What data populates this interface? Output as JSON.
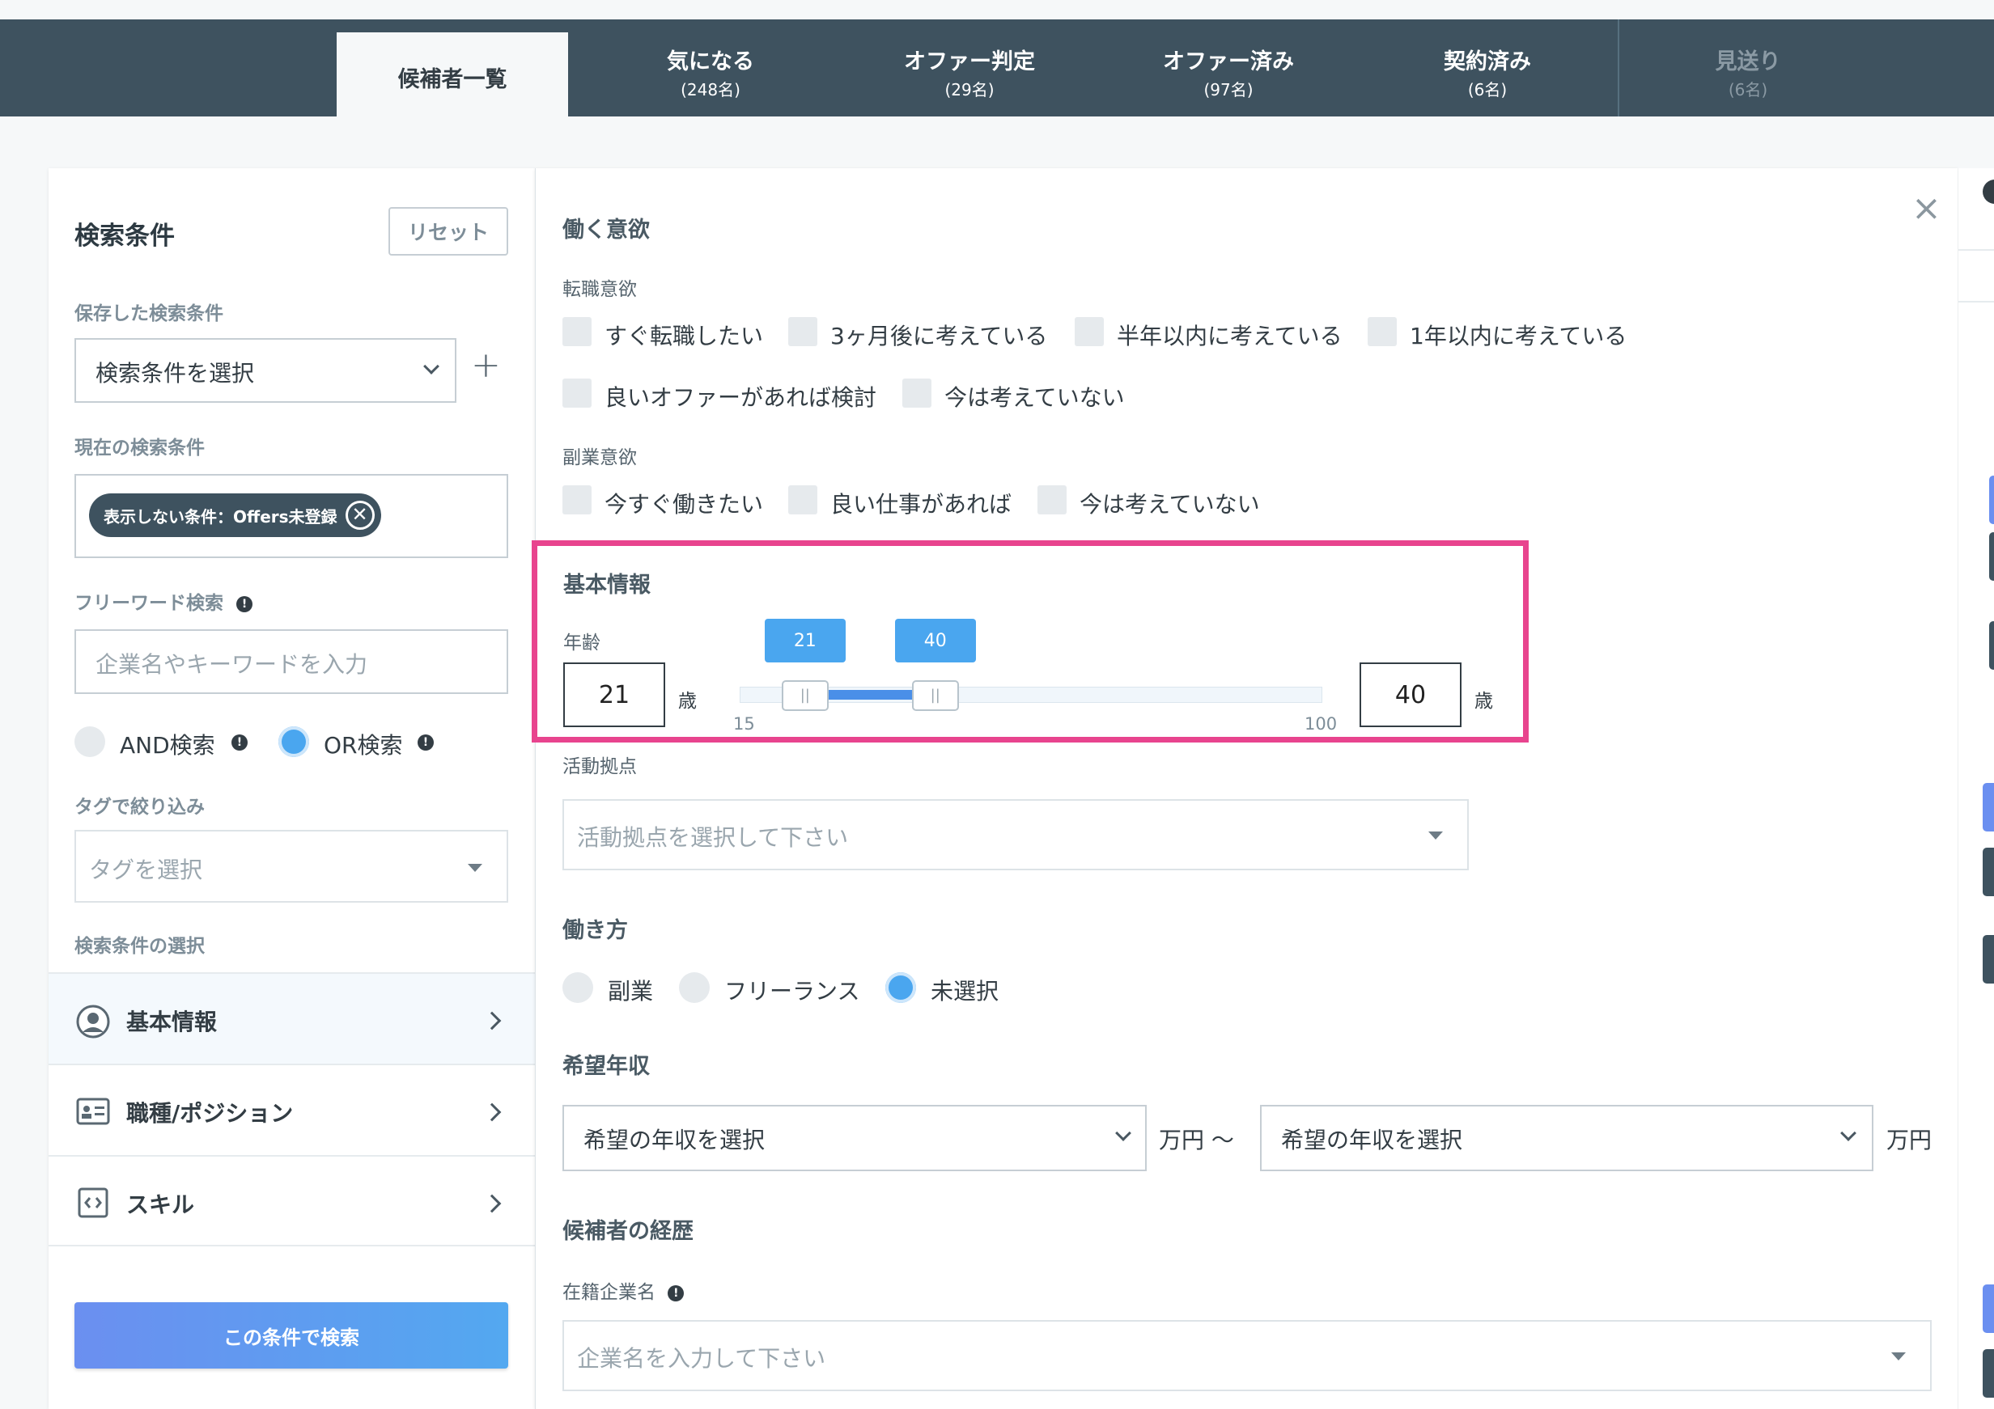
{
  "nav": {
    "tabs": [
      {
        "label": "候補者一覧",
        "count": ""
      },
      {
        "label": "気になる",
        "count": "(248名)"
      },
      {
        "label": "オファー判定",
        "count": "(29名)"
      },
      {
        "label": "オファー済み",
        "count": "(97名)"
      },
      {
        "label": "契約済み",
        "count": "(6名)"
      },
      {
        "label": "見送り",
        "count": "(6名)"
      }
    ]
  },
  "left": {
    "title": "検索条件",
    "reset": "リセット",
    "saved_label": "保存した検索条件",
    "saved_select": "検索条件を選択",
    "add": "+",
    "current_label": "現在の検索条件",
    "chip": "表示しない条件：Offers未登録",
    "free_label": "フリーワード検索",
    "free_placeholder": "企業名やキーワードを入力",
    "and_label": "AND検索",
    "or_label": "OR検索",
    "tag_label": "タグで絞り込み",
    "tag_placeholder": "タグを選択",
    "cond_label": "検索条件の選択",
    "menu": [
      "基本情報",
      "職種/ポジション",
      "スキル"
    ],
    "search_button": "この条件で検索"
  },
  "right": {
    "close": "×",
    "motivation_title": "働く意欲",
    "job_change_label": "転職意欲",
    "job_change_options": [
      "すぐ転職したい",
      "3ヶ月後に考えている",
      "半年以内に考えている",
      "1年以内に考えている",
      "良いオファーがあれば検討",
      "今は考えていない"
    ],
    "side_job_label": "副業意欲",
    "side_job_options": [
      "今すぐ働きたい",
      "良い仕事があれば",
      "今は考えていない"
    ],
    "basic_title": "基本情報",
    "age_label": "年齢",
    "age_min": "21",
    "age_max": "40",
    "age_unit": "歳",
    "slider_min_label": "15",
    "slider_max_label": "100",
    "slider": {
      "min": 15,
      "max": 100,
      "low": 21,
      "high": 40
    },
    "location_label": "活動拠点",
    "location_placeholder": "活動拠点を選択して下さい",
    "workstyle_title": "働き方",
    "workstyle_options": [
      "副業",
      "フリーランス",
      "未選択"
    ],
    "income_title": "希望年収",
    "income_select": "希望の年収を選択",
    "income_unit_range": "万円 〜",
    "income_unit": "万円",
    "career_title": "候補者の経歴",
    "company_label": "在籍企業名",
    "company_placeholder": "企業名を入力して下さい"
  },
  "colors": {
    "nav_bg": "#3e525f",
    "accent": "#4aa6ef",
    "highlight": "#e8448e",
    "search_button": "#5c9bf0"
  }
}
